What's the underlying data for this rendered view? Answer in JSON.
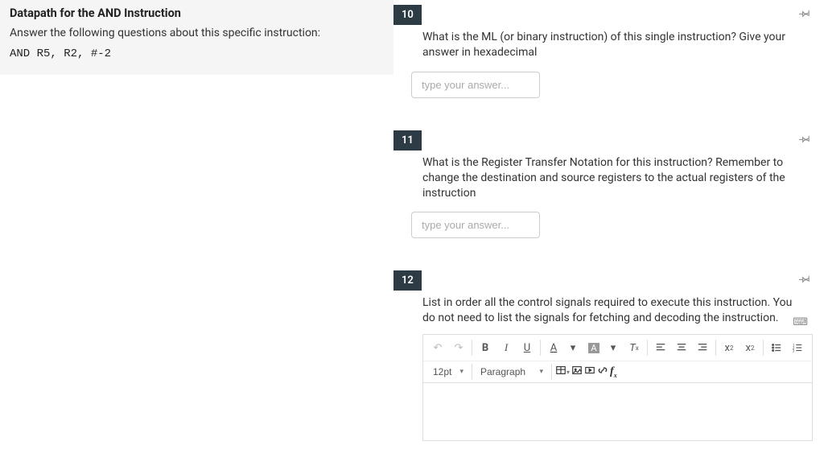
{
  "left": {
    "title": "Datapath for the AND Instruction",
    "instruction": "Answer the following questions about this specific instruction:",
    "code": "AND R5, R2, #-2"
  },
  "questions": [
    {
      "number": "10",
      "points": " ",
      "prompt": "What is the ML (or binary instruction) of this single instruction? Give your answer in hexadecimal",
      "placeholder": "type your answer...",
      "type": "short"
    },
    {
      "number": "11",
      "points": " ",
      "prompt": "What is the Register Transfer Notation for this instruction? Remember to change the destination and source registers to the actual registers of the instruction",
      "placeholder": "type your answer...",
      "type": "short"
    },
    {
      "number": "12",
      "points": " ",
      "prompt": "List in order all the control signals required to execute this instruction. You do not need to list the signals for fetching and decoding the instruction.",
      "type": "rich"
    }
  ],
  "editor": {
    "fontsize": "12pt",
    "block": "Paragraph",
    "buttons": {
      "undo": "↶",
      "redo": "↷",
      "bold": "B",
      "italic": "I",
      "underline": "U",
      "textcolor": "A",
      "bgcolor": "A",
      "clear": "Tx",
      "alignL": "≡",
      "alignC": "≡",
      "alignR": "≡",
      "sup": "x²",
      "sub": "x₂",
      "ul": "≣",
      "ol": "≣",
      "table": "▦",
      "image": "▣",
      "media": "▯",
      "link": "🔗",
      "fx": "fx"
    }
  }
}
